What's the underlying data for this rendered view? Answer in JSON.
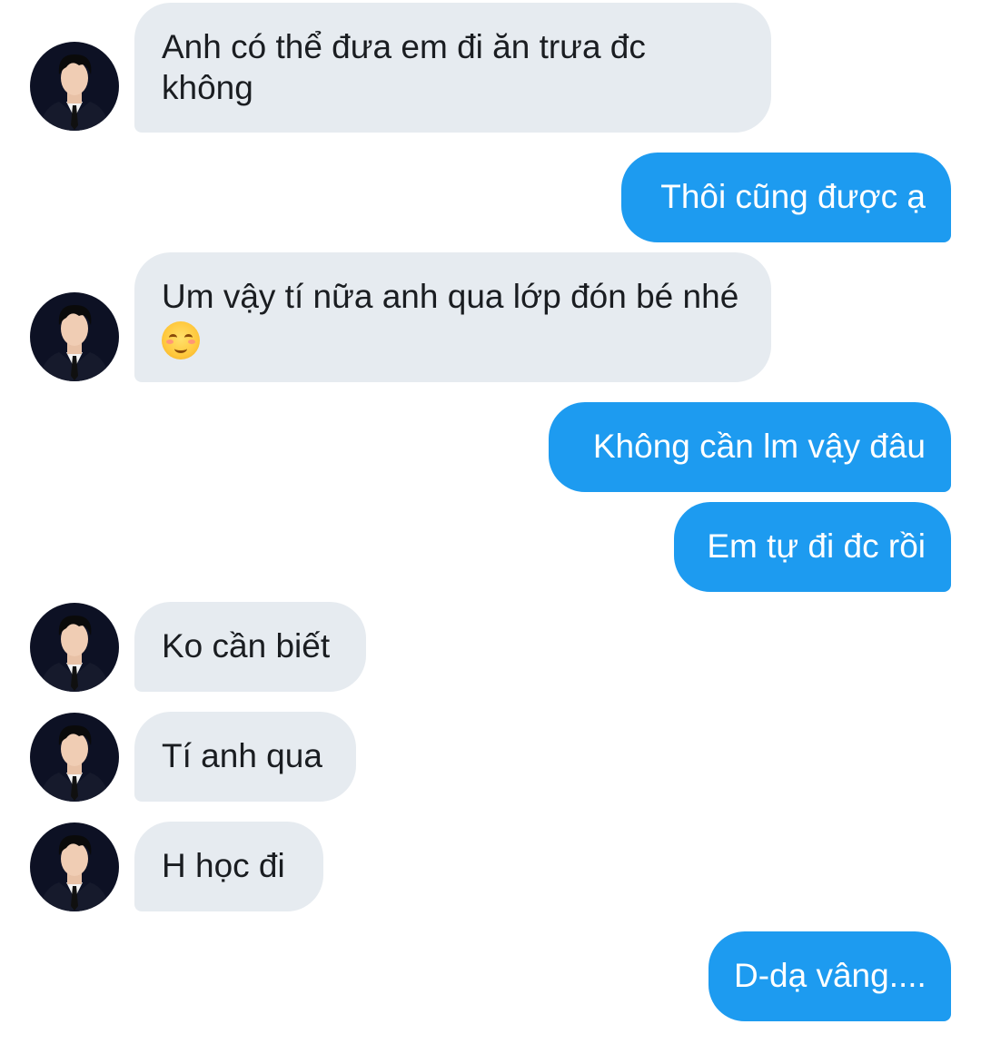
{
  "messages": [
    {
      "sender": "other",
      "lines": [
        "Anh có thể đưa em đi ăn trưa đc",
        "không"
      ]
    },
    {
      "sender": "me",
      "text": "Thôi cũng được ạ"
    },
    {
      "sender": "other",
      "lines": [
        "Um vậy tí nữa anh qua lớp đón bé nhé"
      ],
      "emoji": "smiling-face-with-smiling-eyes"
    },
    {
      "sender": "me",
      "text": "Không cần lm vậy đâu"
    },
    {
      "sender": "me",
      "text": "Em tự đi đc rồi"
    },
    {
      "sender": "other",
      "text": "Ko cần biết"
    },
    {
      "sender": "other",
      "text": "Tí anh qua"
    },
    {
      "sender": "other",
      "text": "H học đi"
    },
    {
      "sender": "me",
      "text": "D-dạ vâng...."
    }
  ],
  "colors": {
    "incoming_bubble": "#e6ebf0",
    "outgoing_bubble": "#1d9bf0",
    "incoming_text": "#1a1d21",
    "outgoing_text": "#ffffff",
    "background": "#ffffff"
  }
}
